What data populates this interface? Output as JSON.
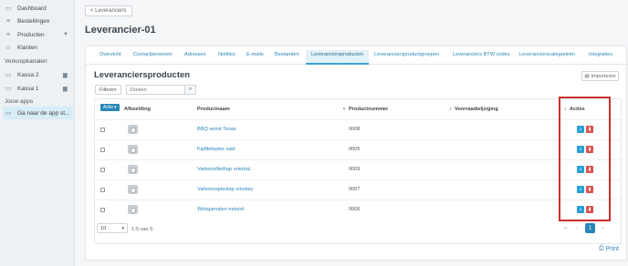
{
  "sidebar": {
    "items": [
      {
        "label": "Dashboard",
        "icon": "dashboard-icon",
        "glyph": "▭"
      },
      {
        "label": "Bestellingen",
        "icon": "cart-icon",
        "glyph": "≡"
      },
      {
        "label": "Producten",
        "icon": "products-icon",
        "glyph": "≡",
        "chevron": "▼"
      },
      {
        "label": "Klanten",
        "icon": "users-icon",
        "glyph": "☺"
      }
    ],
    "section_sales": "Verkoopkanalen",
    "sales_items": [
      {
        "label": "Kassa 2",
        "icon": "pos-icon",
        "glyph": "▭",
        "folder": "▆"
      },
      {
        "label": "Kassa 1",
        "icon": "pos-icon",
        "glyph": "▭",
        "folder": "▆"
      }
    ],
    "section_apps": "Jouw apps",
    "app_item": {
      "label": "Ga naar de app st...",
      "icon": "app-store-icon",
      "glyph": "▭"
    }
  },
  "header": {
    "back_label": "< Leveranciers",
    "page_title": "Leverancier-01"
  },
  "tabs": [
    {
      "label": "Overzicht"
    },
    {
      "label": "Contactpersonen"
    },
    {
      "label": "Adressen"
    },
    {
      "label": "Notities"
    },
    {
      "label": "E-mails"
    },
    {
      "label": "Bestanden"
    },
    {
      "label": "Leveranciersproducten",
      "active": true
    },
    {
      "label": "Leveranciersproductgroepen"
    },
    {
      "label": "Leveranciers BTW codes"
    },
    {
      "label": "Leverancierscategorieën"
    },
    {
      "label": "Integraties"
    }
  ],
  "section": {
    "title": "Leveranciersproducten",
    "import_label": "Importeren",
    "filter_label": "Filteren",
    "search_placeholder": "Zoeken"
  },
  "table": {
    "actions_label": "Actie",
    "columns": [
      "Afbeelding",
      "Productnaam",
      "Productnummer",
      "Voorraadwijziging",
      "Acties"
    ],
    "rows": [
      {
        "name": "BBQ worst Texas",
        "number": "0008"
      },
      {
        "name": "Kipfiletspies saté",
        "number": "0005"
      },
      {
        "name": "Varkensfilethap oriental",
        "number": "0009"
      },
      {
        "name": "Varkensspieslap smokey",
        "number": "0007"
      },
      {
        "name": "Wokgarnalen naturel",
        "number": "0006"
      }
    ]
  },
  "pagination": {
    "per_page": "10",
    "range": "1-5 van 5",
    "first": "«",
    "prev": "‹",
    "current": "1",
    "next": "›"
  },
  "print_label": "Print",
  "colors": {
    "accent": "#2a86b8",
    "danger": "#d9534f",
    "highlight": "#c9302c"
  }
}
